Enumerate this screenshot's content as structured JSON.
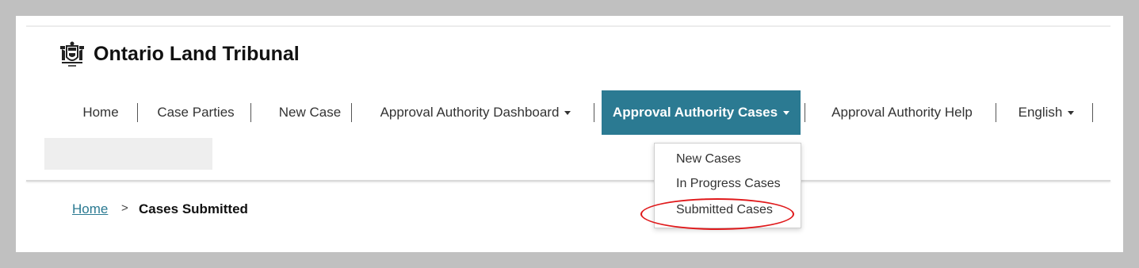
{
  "site": {
    "title": "Ontario Land Tribunal",
    "logo_icon": "ontario-coat-of-arms-icon"
  },
  "nav": {
    "items": [
      {
        "label": "Home"
      },
      {
        "label": "Case Parties"
      },
      {
        "label": "New Case"
      },
      {
        "label": "Approval Authority Dashboard"
      },
      {
        "label": "Approval Authority Cases"
      },
      {
        "label": "Approval Authority Help"
      },
      {
        "label": "English"
      }
    ],
    "active_index": 4,
    "active_color": "#2b7a92"
  },
  "dropdown": {
    "items": [
      {
        "label": "New Cases"
      },
      {
        "label": "In Progress Cases"
      },
      {
        "label": "Submitted Cases"
      }
    ],
    "highlighted_index": 2,
    "highlight_color": "#e0191b"
  },
  "breadcrumb": {
    "home": "Home",
    "separator": ">",
    "current": "Cases Submitted"
  }
}
